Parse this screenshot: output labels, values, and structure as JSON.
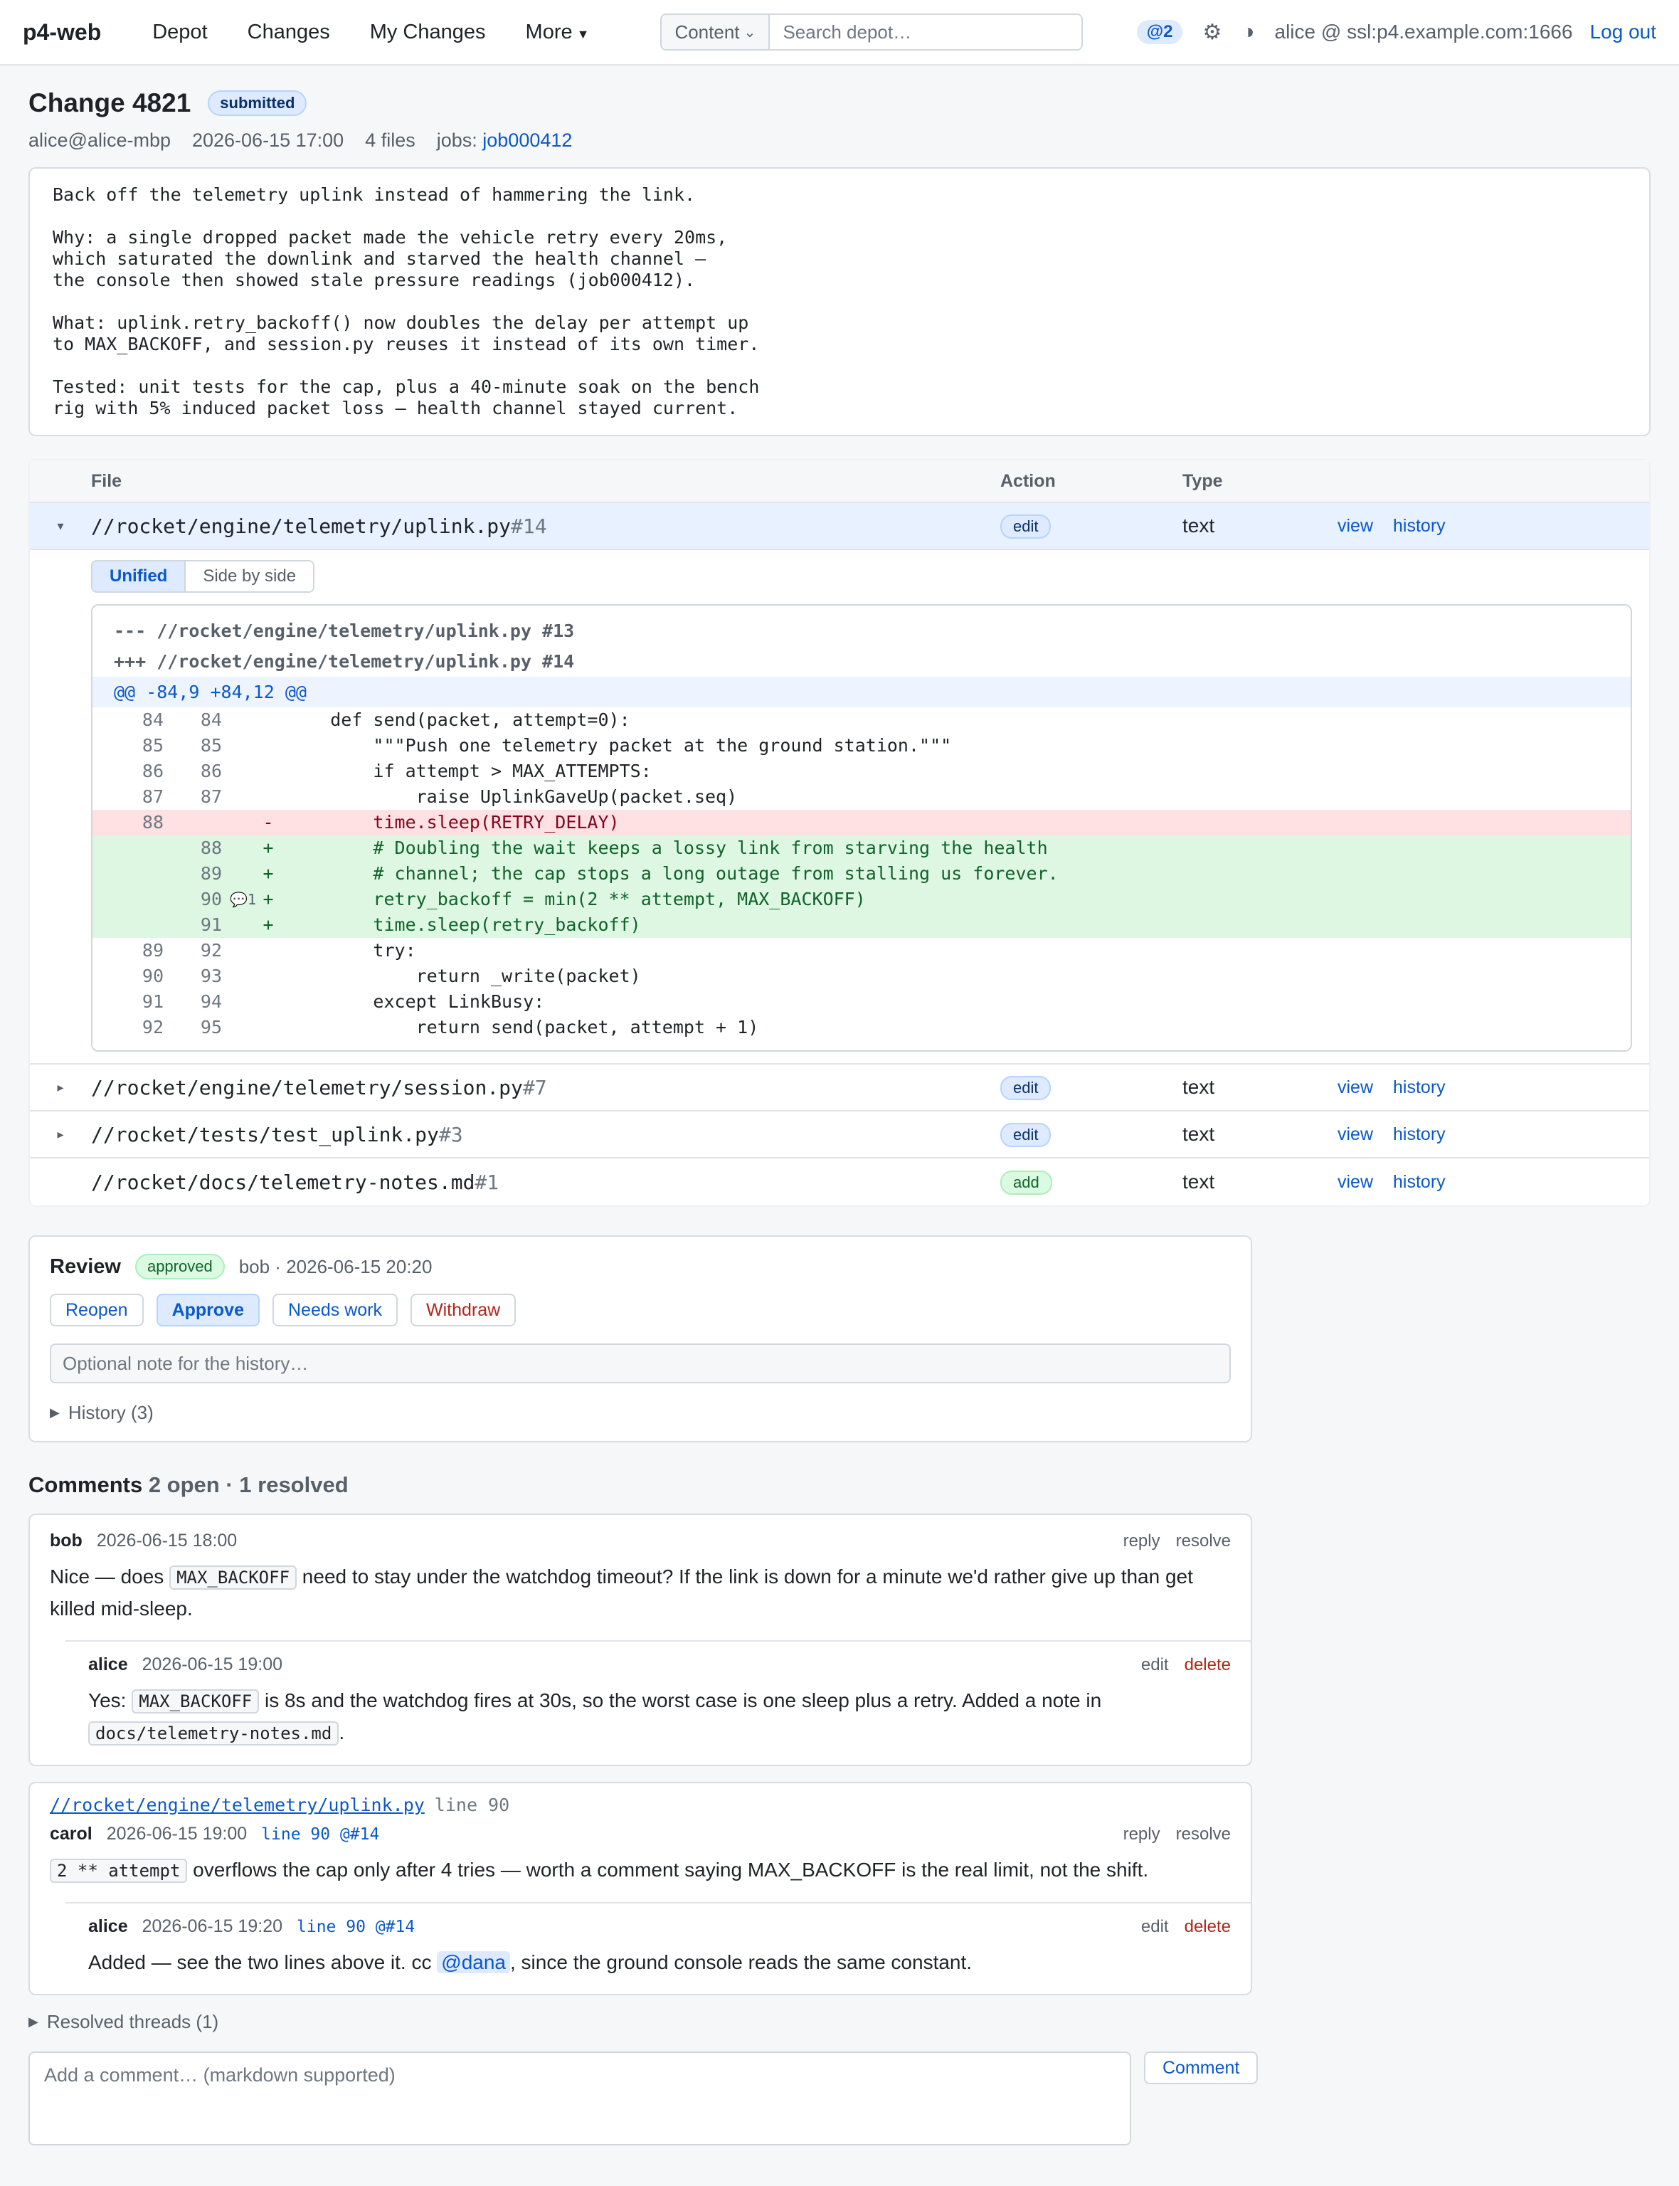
{
  "nav": {
    "brand": "p4-web",
    "items": [
      "Depot",
      "Changes",
      "My Changes",
      "More"
    ],
    "search_scope": "Content",
    "search_placeholder": "Search depot…",
    "notif": "@2",
    "user": "alice @ ssl:p4.example.com:1666",
    "logout": "Log out"
  },
  "change": {
    "title": "Change 4821",
    "status": "submitted",
    "client": "alice@alice-mbp",
    "date": "2026-06-15 17:00",
    "files": "4 files",
    "jobs_label": "jobs:",
    "job": "job000412",
    "description": "Back off the telemetry uplink instead of hammering the link.\n\nWhy: a single dropped packet made the vehicle retry every 20ms,\nwhich saturated the downlink and starved the health channel —\nthe console then showed stale pressure readings (job000412).\n\nWhat: uplink.retry_backoff() now doubles the delay per attempt up\nto MAX_BACKOFF, and session.py reuses it instead of its own timer.\n\nTested: unit tests for the cap, plus a 40-minute soak on the bench\nrig with 5% induced packet loss — health channel stayed current."
  },
  "files_table": {
    "headers": [
      "File",
      "Action",
      "Type"
    ],
    "view": "view",
    "history": "history",
    "rows": [
      {
        "toggle": "▾",
        "path": "//rocket/engine/telemetry/uplink.py",
        "rev": "#14",
        "action": "edit",
        "type": "text"
      },
      {
        "toggle": "▸",
        "path": "//rocket/engine/telemetry/session.py",
        "rev": "#7",
        "action": "edit",
        "type": "text"
      },
      {
        "toggle": "▸",
        "path": "//rocket/tests/test_uplink.py",
        "rev": "#3",
        "action": "edit",
        "type": "text"
      },
      {
        "toggle": "",
        "path": "//rocket/docs/telemetry-notes.md",
        "rev": "#1",
        "action": "add",
        "type": "text"
      }
    ]
  },
  "diff": {
    "modes": [
      "Unified",
      "Side by side"
    ],
    "old_header": "--- //rocket/engine/telemetry/uplink.py #13",
    "new_header": "+++ //rocket/engine/telemetry/uplink.py #14",
    "hunk": "@@ -84,9 +84,12 @@",
    "lines": [
      {
        "t": "ctx",
        "o": "84",
        "n": "84",
        "s": "",
        "c": "    def send(packet, attempt=0):"
      },
      {
        "t": "ctx",
        "o": "85",
        "n": "85",
        "s": "",
        "c": "        \"\"\"Push one telemetry packet at the ground station.\"\"\""
      },
      {
        "t": "ctx",
        "o": "86",
        "n": "86",
        "s": "",
        "c": "        if attempt > MAX_ATTEMPTS:"
      },
      {
        "t": "ctx",
        "o": "87",
        "n": "87",
        "s": "",
        "c": "            raise UplinkGaveUp(packet.seq)"
      },
      {
        "t": "del",
        "o": "88",
        "n": "",
        "s": "-",
        "c": "        time.sleep(RETRY_DELAY)"
      },
      {
        "t": "ins",
        "o": "",
        "n": "88",
        "s": "+",
        "c": "        # Doubling the wait keeps a lossy link from starving the health"
      },
      {
        "t": "ins",
        "o": "",
        "n": "89",
        "s": "+",
        "c": "        # channel; the cap stops a long outage from stalling us forever."
      },
      {
        "t": "ins",
        "o": "",
        "n": "90",
        "s": "+",
        "m": "💬1",
        "c": "        retry_backoff = min(2 ** attempt, MAX_BACKOFF)"
      },
      {
        "t": "ins",
        "o": "",
        "n": "91",
        "s": "+",
        "c": "        time.sleep(retry_backoff)"
      },
      {
        "t": "ctx",
        "o": "89",
        "n": "92",
        "s": "",
        "c": "        try:"
      },
      {
        "t": "ctx",
        "o": "90",
        "n": "93",
        "s": "",
        "c": "            return _write(packet)"
      },
      {
        "t": "ctx",
        "o": "91",
        "n": "94",
        "s": "",
        "c": "        except LinkBusy:"
      },
      {
        "t": "ctx",
        "o": "92",
        "n": "95",
        "s": "",
        "c": "            return send(packet, attempt + 1)"
      }
    ]
  },
  "review": {
    "title": "Review",
    "status": "approved",
    "meta": "bob · 2026-06-15 20:20",
    "buttons": [
      "Reopen",
      "Approve",
      "Needs work",
      "Withdraw"
    ],
    "note_placeholder": "Optional note for the history…",
    "history": "History (3)"
  },
  "comments": {
    "title": "Comments",
    "summary": "2 open · 1 resolved",
    "t1": {
      "c1": {
        "author": "bob",
        "time": "2026-06-15 18:00",
        "reply": "reply",
        "resolve": "resolve",
        "b1": "Nice — does ",
        "code": "MAX_BACKOFF",
        "b2": " need to stay under the watchdog timeout? If the link is down for a minute we'd rather give up than get killed mid-sleep."
      },
      "c2": {
        "author": "alice",
        "time": "2026-06-15 19:00",
        "edit": "edit",
        "delete": "delete",
        "b1": "Yes: ",
        "code": "MAX_BACKOFF",
        "b2": " is 8s and the watchdog fires at 30s, so the worst case is one sleep plus a retry. Added a note in ",
        "code2": "docs/telemetry-notes.md",
        "b3": "."
      }
    },
    "t2": {
      "file": "//rocket/engine/telemetry/uplink.py",
      "line": "line 90",
      "c1": {
        "author": "carol",
        "time": "2026-06-15 19:00",
        "lineref": "line 90 @#14",
        "reply": "reply",
        "resolve": "resolve",
        "code": "2 ** attempt",
        "b1": " overflows the cap only after 4 tries — worth a comment saying MAX_BACKOFF is the real limit, not the shift."
      },
      "c2": {
        "author": "alice",
        "time": "2026-06-15 19:20",
        "lineref": "line 90 @#14",
        "edit": "edit",
        "delete": "delete",
        "b1": "Added — see the two lines above it. cc ",
        "mention": "@dana",
        "b2": ", since the ground console reads the same constant."
      }
    },
    "resolved": "Resolved threads (1)",
    "new_placeholder": "Add a comment… (markdown supported)",
    "submit": "Comment"
  }
}
